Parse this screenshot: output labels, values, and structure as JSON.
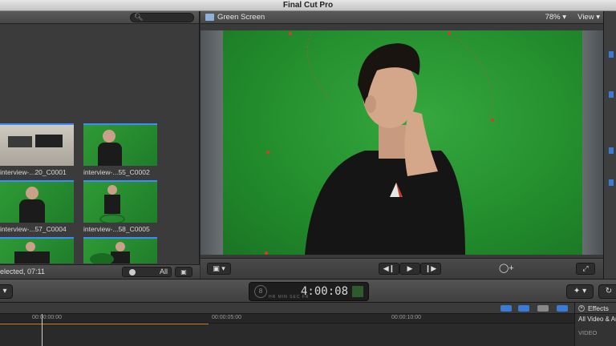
{
  "window": {
    "title": "Final Cut Pro"
  },
  "browser": {
    "search_icon": "search-icon",
    "clips": [
      {
        "name": "interview-...20_C0001",
        "kind": "gear"
      },
      {
        "name": "interview-...55_C0002",
        "kind": "green"
      },
      {
        "name": "interview-...57_C0004",
        "kind": "green"
      },
      {
        "name": "interview-...58_C0005",
        "kind": "green"
      },
      {
        "name": "",
        "kind": "green"
      },
      {
        "name": "",
        "kind": "green"
      }
    ],
    "selection_info": "elected, 07:11",
    "filter_label": "All",
    "colors": {
      "accent": "#3a8cff"
    }
  },
  "viewer": {
    "title": "Green Screen",
    "zoom": "78%",
    "view_menu": "View",
    "colors": {
      "green_screen": "#2a9a34",
      "keyframe": "#d93c2a"
    }
  },
  "toolbar": {
    "timecode": "4:00:08",
    "timecode_ring": "8",
    "timecode_labels": "HR MIN SEC FR"
  },
  "timeline": {
    "ruler_labels": [
      "00:00:00:00",
      "00:00:05:00",
      "00:00:10:00"
    ]
  },
  "effects": {
    "title": "Effects",
    "category": "All Video & Audio",
    "section": "VIDEO"
  }
}
